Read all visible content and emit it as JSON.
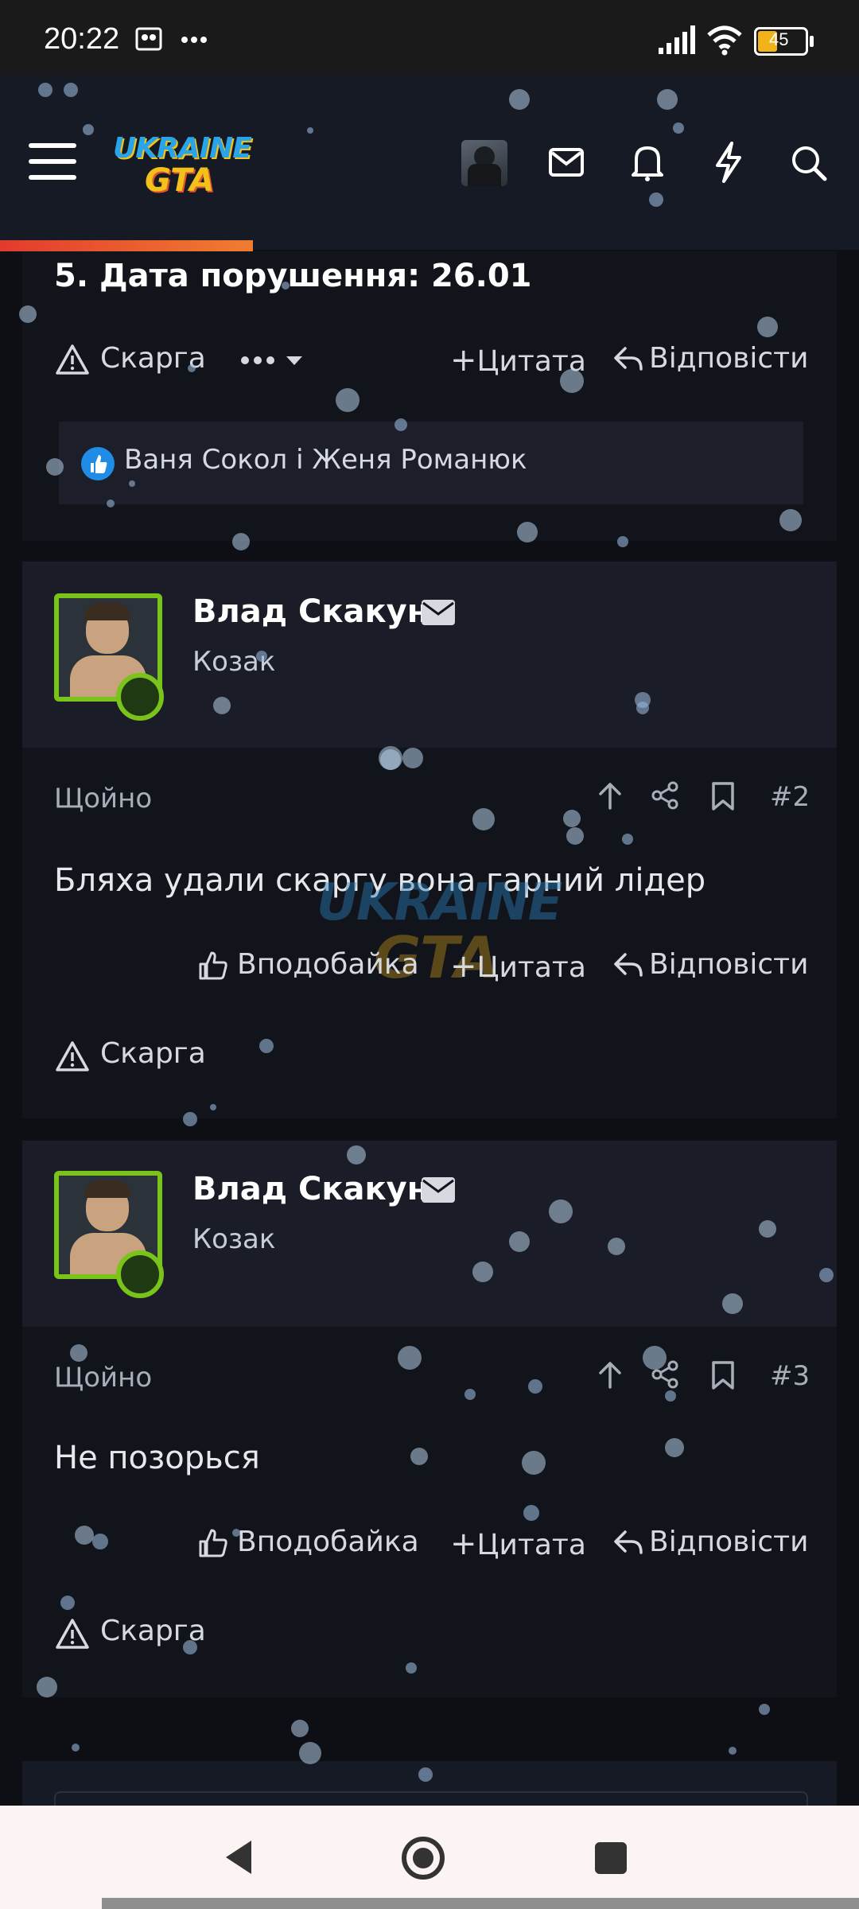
{
  "status_bar": {
    "time": "20:22",
    "battery": "45"
  },
  "header": {
    "logo_line1": "UKRAINE",
    "logo_line2": "GTA"
  },
  "post1": {
    "tail_text": "5. Дата порушення: 26.01",
    "report_label": "Скарга",
    "quote_label": "Цитата",
    "reply_label": "Відповісти",
    "reactions_text": "Ваня Сокол і Женя Романюк"
  },
  "posts": [
    {
      "author": "Влад Скакун",
      "rank": "Козак",
      "time": "Щойно",
      "number": "#2",
      "body": "Бляха удали скаргу вона гарний лідер",
      "like_label": "Вподобайка",
      "quote_label": "Цитата",
      "reply_label": "Відповісти",
      "report_label": "Скарга"
    },
    {
      "author": "Влад Скакун",
      "rank": "Козак",
      "time": "Щойно",
      "number": "#3",
      "body": "Не позорься",
      "like_label": "Вподобайка",
      "quote_label": "Цитата",
      "reply_label": "Відповісти",
      "report_label": "Скарга"
    }
  ],
  "watermark": {
    "line1": "UKRAINE",
    "line2": "GTA"
  },
  "colors": {
    "accent_green": "#79c31a",
    "progress_start": "#e23b2e",
    "progress_end": "#f07d2f",
    "like_blue": "#1f8ce6"
  }
}
